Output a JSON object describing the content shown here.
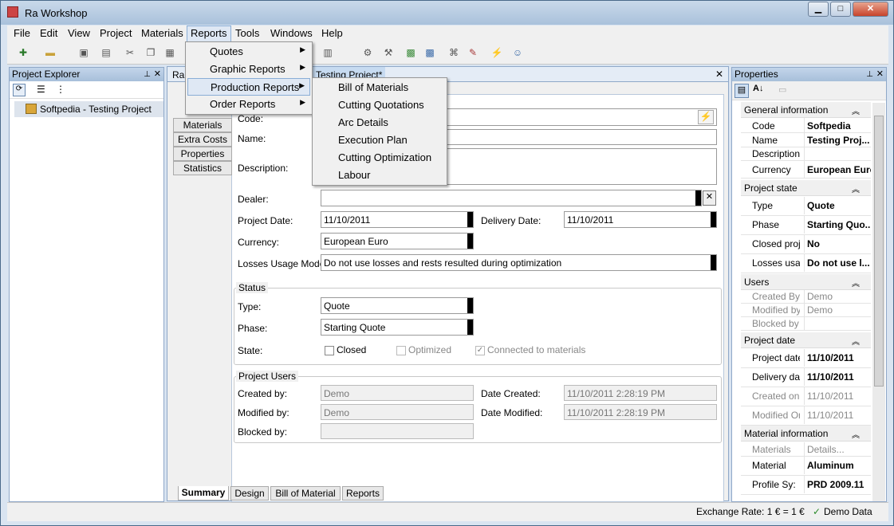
{
  "window": {
    "title": "Ra Workshop",
    "min": "▁",
    "max": "□",
    "close": "✕"
  },
  "menubar": [
    "File",
    "Edit",
    "View",
    "Project",
    "Materials",
    "Reports",
    "Tools",
    "Windows",
    "Help"
  ],
  "reports_menu": {
    "items": [
      "Quotes",
      "Graphic Reports",
      "Production Reports",
      "Order Reports"
    ],
    "highlighted": "Production Reports"
  },
  "production_submenu": {
    "items": [
      "Bill of Materials",
      "Cutting Quotations",
      "Arc Details",
      "Execution Plan",
      "Cutting Optimization",
      "Labour"
    ]
  },
  "project_explorer": {
    "title": "Project Explorer",
    "tree_item": "Softpedia - Testing Project"
  },
  "document": {
    "tab_short": "Ra",
    "tab_title": "Testing Project*",
    "close": "✕",
    "side_tabs": [
      "Materials",
      "Extra Costs",
      "Properties",
      "Statistics"
    ],
    "bottom_tabs": [
      "Summary",
      "Design",
      "Bill of Material",
      "Reports"
    ],
    "labels": {
      "code": "Code:",
      "name": "Name:",
      "description": "Description:",
      "dealer": "Dealer:",
      "project_date": "Project Date:",
      "delivery_date": "Delivery Date:",
      "currency": "Currency:",
      "losses": "Losses Usage Mode:"
    },
    "values": {
      "code": "",
      "name": "",
      "description": "",
      "dealer": "",
      "project_date": "11/10/2011",
      "delivery_date": "11/10/2011",
      "currency": "European Euro",
      "losses": "Do not use losses and rests resulted during optimization"
    },
    "status": {
      "title": "Status",
      "type_label": "Type:",
      "type": "Quote",
      "phase_label": "Phase:",
      "phase": "Starting Quote",
      "state_label": "State:",
      "closed": "Closed",
      "optimized": "Optimized",
      "connected": "Connected to materials"
    },
    "users": {
      "title": "Project Users",
      "created_by_label": "Created by:",
      "created_by": "Demo",
      "modified_by_label": "Modified by:",
      "modified_by": "Demo",
      "blocked_by_label": "Blocked by:",
      "blocked_by": "",
      "date_created_label": "Date Created:",
      "date_created": "11/10/2011 2:28:19 PM",
      "date_modified_label": "Date Modified:",
      "date_modified": "11/10/2011 2:28:19 PM"
    }
  },
  "properties": {
    "title": "Properties",
    "cats": {
      "general": "General information",
      "state": "Project state",
      "users": "Users",
      "date": "Project date",
      "material": "Material information"
    },
    "rows": [
      {
        "k": "Code",
        "v": "Softpedia"
      },
      {
        "k": "Name",
        "v": "Testing Proj..."
      },
      {
        "k": "Description",
        "v": ""
      },
      {
        "k": "Currency",
        "v": "European Euro"
      },
      {
        "k": "Type",
        "v": "Quote"
      },
      {
        "k": "Phase",
        "v": "Starting Quo..."
      },
      {
        "k": "Closed proje",
        "v": "No"
      },
      {
        "k": "Losses usag",
        "v": "Do not use l..."
      },
      {
        "k": "Created By",
        "v": "Demo"
      },
      {
        "k": "Modified by",
        "v": "Demo"
      },
      {
        "k": "Blocked by",
        "v": ""
      },
      {
        "k": "Project date",
        "v": "11/10/2011"
      },
      {
        "k": "Delivery dat",
        "v": "11/10/2011"
      },
      {
        "k": "Created on",
        "v": "11/10/2011"
      },
      {
        "k": "Modified On",
        "v": "11/10/2011"
      },
      {
        "k": "Materials",
        "v": "Details..."
      },
      {
        "k": "Material",
        "v": "Aluminum"
      },
      {
        "k": "Profile Sy:",
        "v": "PRD 2009.11"
      }
    ]
  },
  "statusbar": {
    "exchange": "Exchange Rate: 1 € = 1 €",
    "demo": "Demo Data"
  }
}
